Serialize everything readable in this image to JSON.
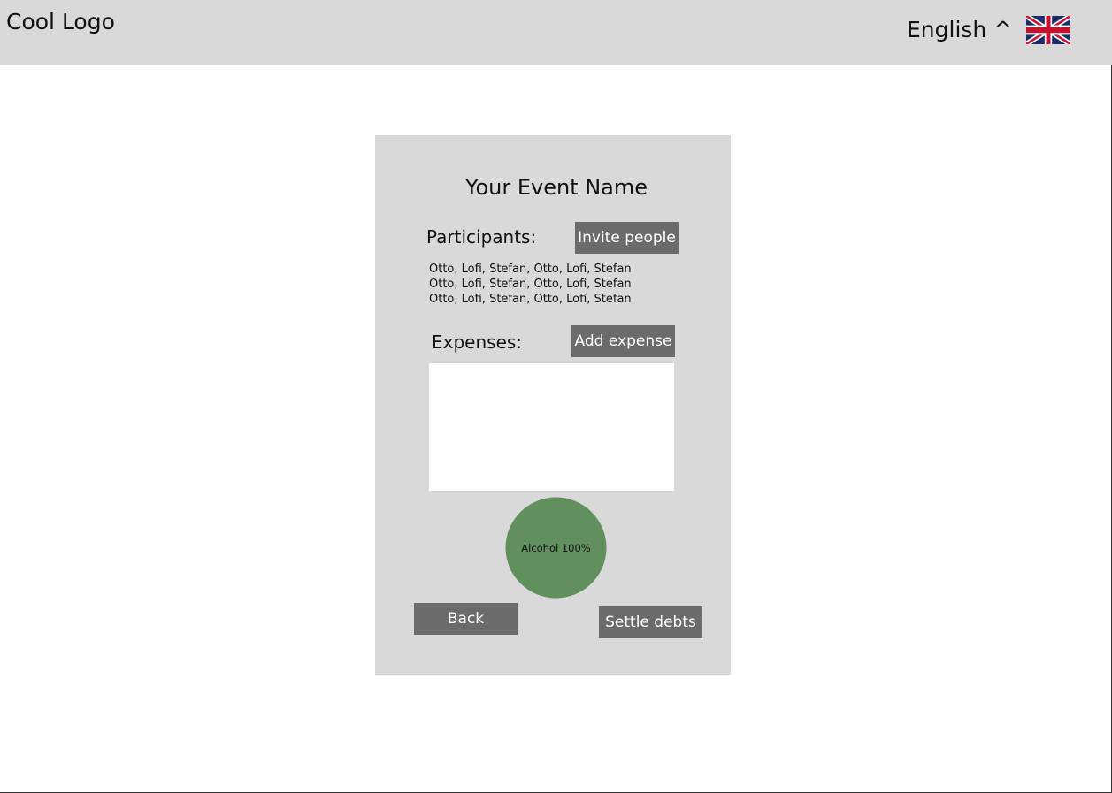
{
  "header": {
    "logo": "Cool Logo",
    "language": "English ^",
    "flag_icon": "uk-flag-icon"
  },
  "event": {
    "title": "Your Event Name",
    "participants_label": "Participants:",
    "invite_button": "Invite people",
    "participants_lines": [
      "Otto, Lofi, Stefan, Otto, Lofi, Stefan",
      "Otto, Lofi, Stefan, Otto, Lofi, Stefan",
      "Otto, Lofi, Stefan, Otto, Lofi, Stefan"
    ],
    "expenses_label": "Expenses:",
    "add_expense_button": "Add expense",
    "back_button": "Back",
    "settle_button": "Settle debts"
  },
  "chart_data": {
    "type": "pie",
    "categories": [
      "Alcohol"
    ],
    "values": [
      100
    ],
    "labels": [
      "Alcohol 100%"
    ],
    "colors": [
      "#618f5e"
    ]
  },
  "colors": {
    "header_bg": "#d9d9d9",
    "card_bg": "#d9d9d9",
    "button_bg": "#6b6b6b",
    "pie_green": "#618f5e"
  }
}
